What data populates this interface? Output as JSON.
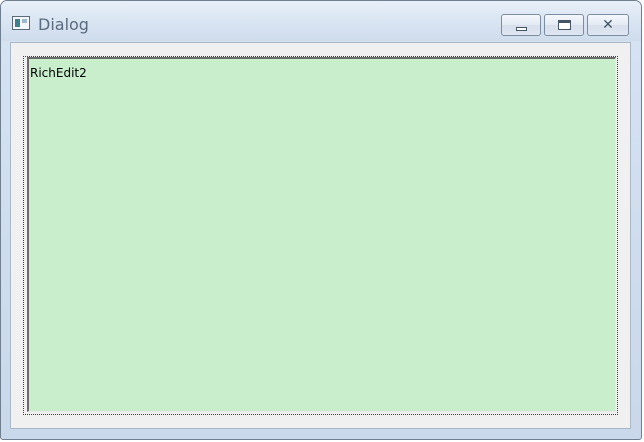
{
  "window": {
    "title": "Dialog",
    "icon": "app-window-icon",
    "controls": {
      "minimize_icon": "minimize-icon",
      "maximize_icon": "maximize-icon",
      "close_icon": "close-icon",
      "close_glyph": "✕"
    }
  },
  "dialog": {
    "richedit": {
      "text": "RichEdit2",
      "background_color": "#c8eecc"
    }
  }
}
